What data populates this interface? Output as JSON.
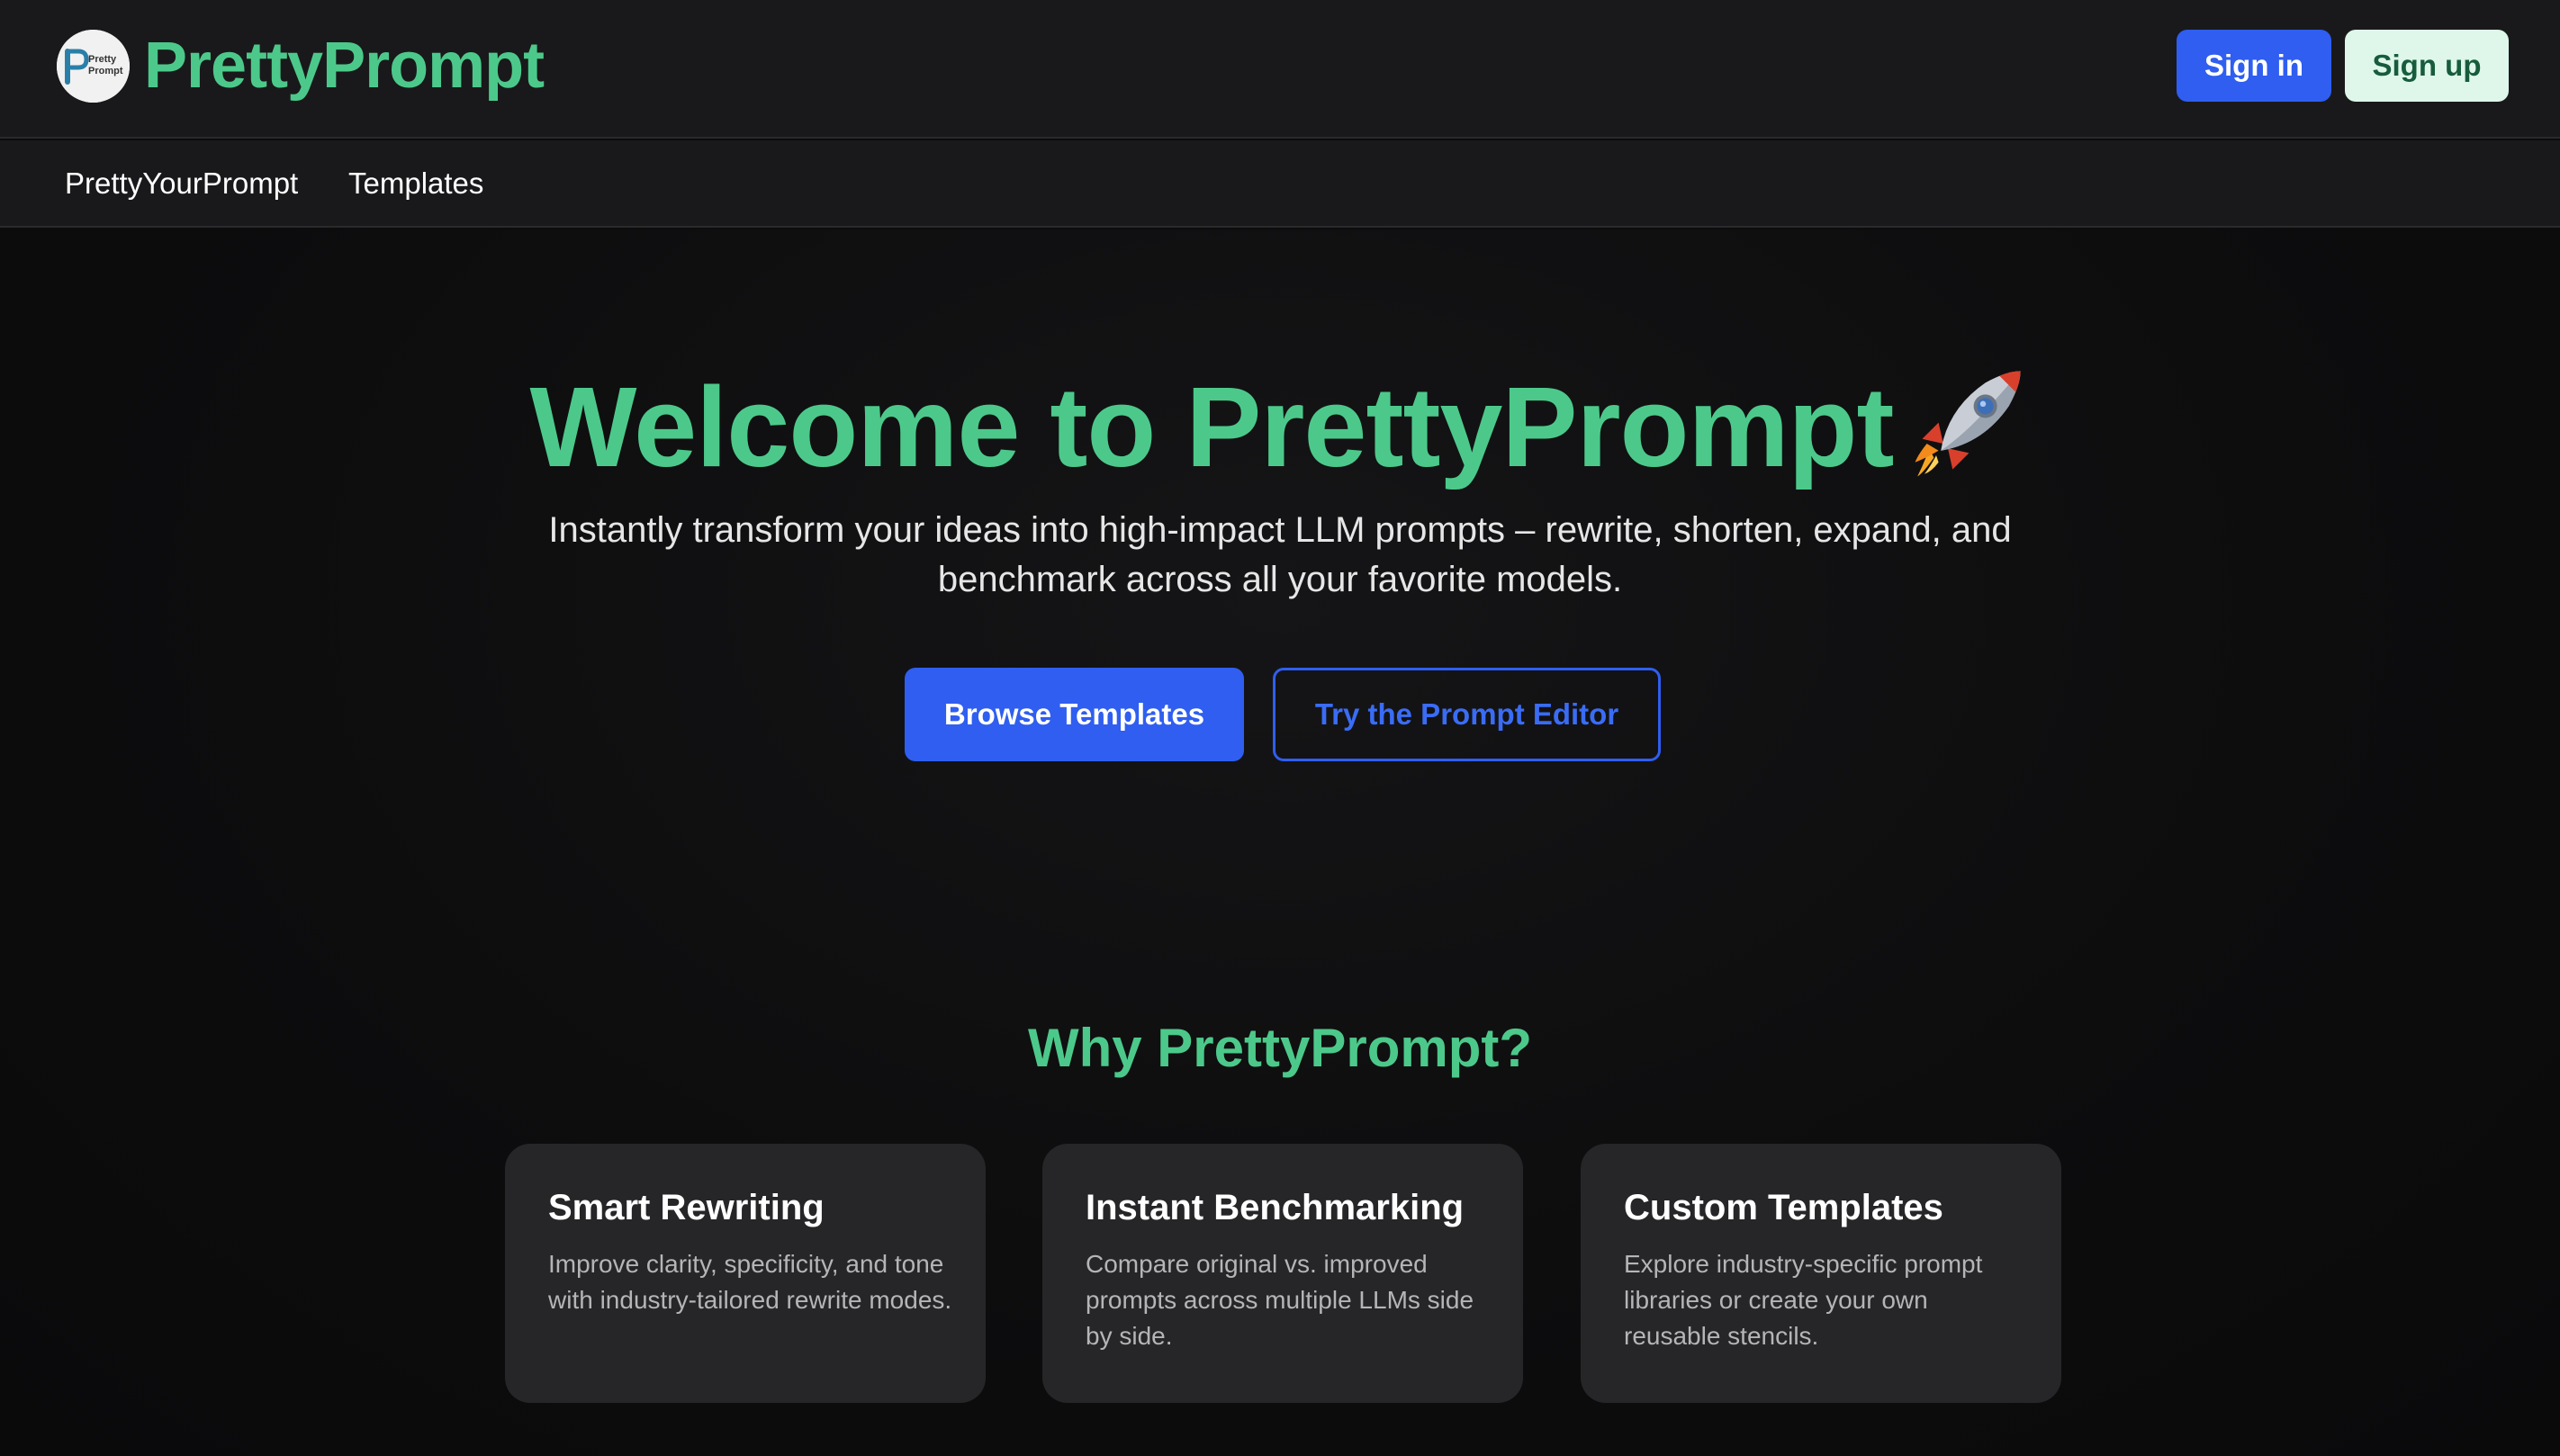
{
  "header": {
    "logo_icon": "prettyprompt-logo",
    "logo_text_top": "Pretty",
    "logo_text_bottom": "Prompt",
    "brand": "PrettyPrompt",
    "signin_label": "Sign in",
    "signup_label": "Sign up"
  },
  "nav": {
    "items": [
      {
        "label": "PrettyYourPrompt"
      },
      {
        "label": "Templates"
      }
    ]
  },
  "hero": {
    "title": "Welcome to PrettyPrompt",
    "title_icon": "rocket-icon",
    "subtitle": "Instantly transform your ideas into high-impact LLM prompts – rewrite, shorten, expand, and benchmark across all your favorite models.",
    "browse_label": "Browse Templates",
    "editor_label": "Try the Prompt Editor"
  },
  "features": {
    "title": "Why PrettyPrompt?",
    "cards": [
      {
        "title": "Smart Rewriting",
        "desc": "Improve clarity, specificity, and tone with industry-tailored rewrite modes."
      },
      {
        "title": "Instant Benchmarking",
        "desc": "Compare original vs. improved prompts across multiple LLMs side by side."
      },
      {
        "title": "Custom Templates",
        "desc": "Explore industry-specific prompt libraries or create your own reusable stencils."
      }
    ]
  },
  "colors": {
    "brand_green": "#4cc98a",
    "primary_blue": "#2f5ef0",
    "signup_bg": "#def7ea",
    "signup_text": "#175c3c",
    "header_bg": "#19191b",
    "card_bg": "#262628"
  }
}
